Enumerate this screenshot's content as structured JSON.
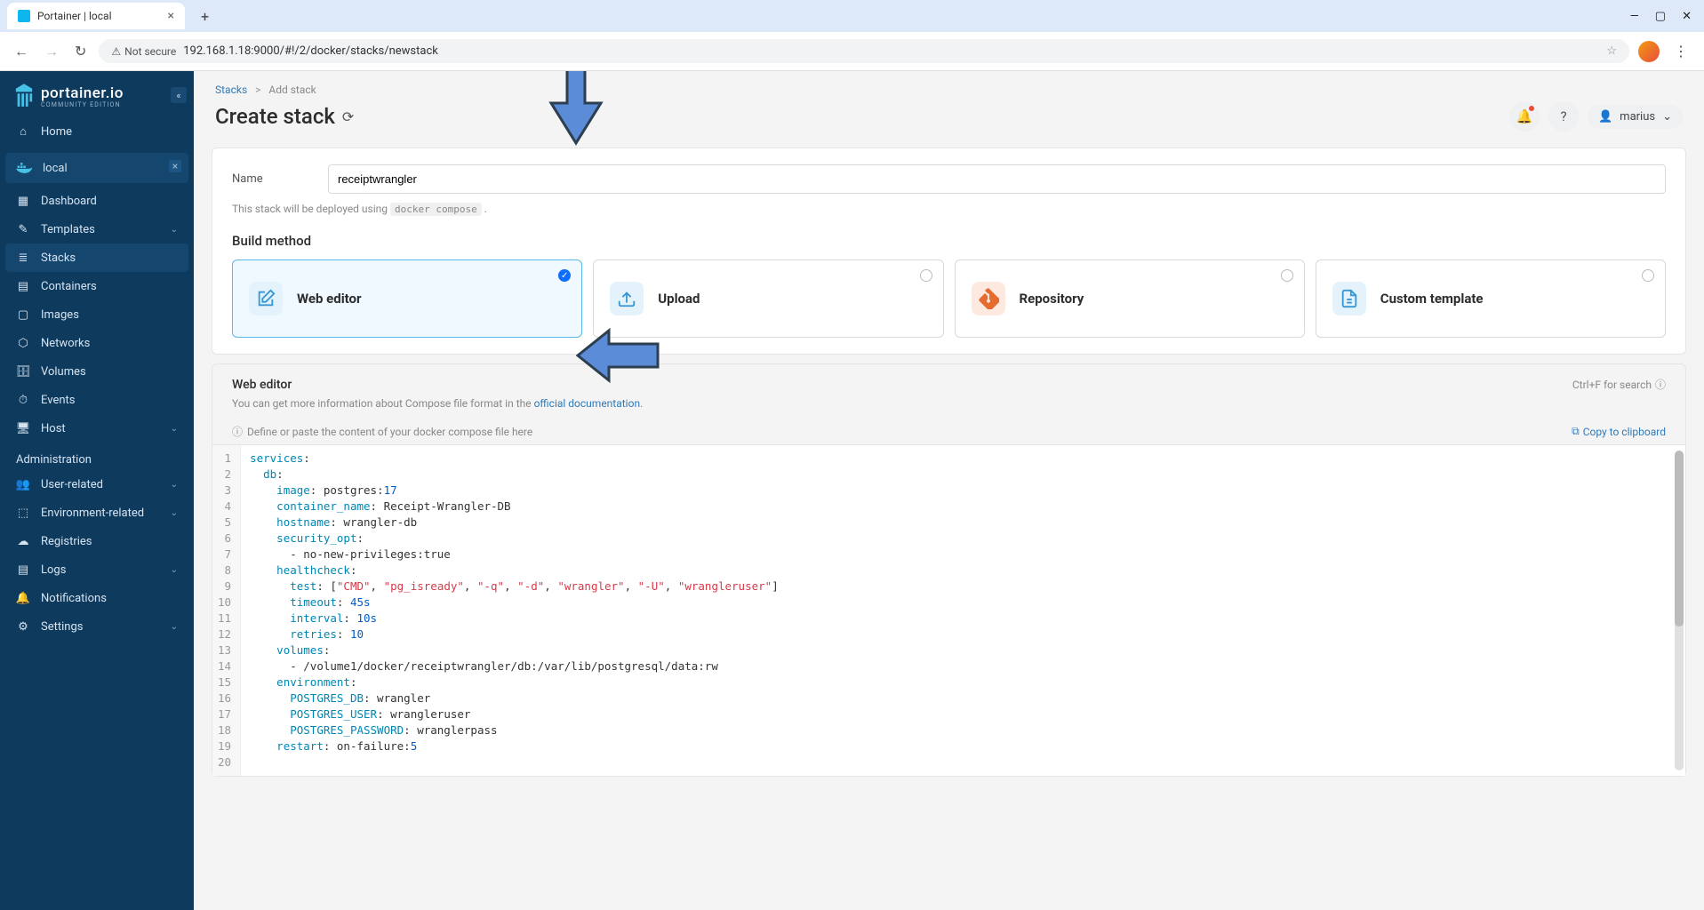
{
  "browser": {
    "tab_title": "Portainer | local",
    "security_label": "Not secure",
    "url": "192.168.1.18:9000/#!/2/docker/stacks/newstack"
  },
  "sidebar": {
    "brand": "portainer.io",
    "edition": "COMMUNITY EDITION",
    "home": "Home",
    "env_name": "local",
    "items": [
      {
        "label": "Dashboard"
      },
      {
        "label": "Templates",
        "chev": true
      },
      {
        "label": "Stacks",
        "active": true
      },
      {
        "label": "Containers"
      },
      {
        "label": "Images"
      },
      {
        "label": "Networks"
      },
      {
        "label": "Volumes"
      },
      {
        "label": "Events"
      },
      {
        "label": "Host",
        "chev": true
      }
    ],
    "admin_label": "Administration",
    "admin_items": [
      {
        "label": "User-related",
        "chev": true
      },
      {
        "label": "Environment-related",
        "chev": true
      },
      {
        "label": "Registries"
      },
      {
        "label": "Logs",
        "chev": true
      },
      {
        "label": "Notifications"
      },
      {
        "label": "Settings",
        "chev": true
      }
    ]
  },
  "breadcrumb": {
    "parent": "Stacks",
    "current": "Add stack"
  },
  "page": {
    "title": "Create stack",
    "username": "marius"
  },
  "form": {
    "name_label": "Name",
    "name_value": "receiptwrangler",
    "deploy_note_pre": "This stack will be deployed using ",
    "deploy_note_code": "docker compose",
    "build_method_label": "Build method"
  },
  "methods": [
    {
      "label": "Web editor",
      "selected": true,
      "icon": "edit",
      "tone": "blue"
    },
    {
      "label": "Upload",
      "icon": "upload",
      "tone": "blue"
    },
    {
      "label": "Repository",
      "icon": "git",
      "tone": "orange"
    },
    {
      "label": "Custom template",
      "icon": "template",
      "tone": "blue"
    }
  ],
  "editor": {
    "title": "Web editor",
    "search_hint": "Ctrl+F for search",
    "desc_pre": "You can get more information about Compose file format in the ",
    "desc_link": "official documentation",
    "hint": "Define or paste the content of your docker compose file here",
    "copy_label": "Copy to clipboard"
  },
  "code": {
    "lines": [
      [
        {
          "t": "services",
          "c": "k-key"
        },
        {
          "t": ":",
          "c": "k-punc"
        }
      ],
      [
        {
          "t": "  db",
          "c": "k-key"
        },
        {
          "t": ":",
          "c": "k-punc"
        }
      ],
      [
        {
          "t": "    image",
          "c": "k-key"
        },
        {
          "t": ": postgres:",
          "c": "k-punc"
        },
        {
          "t": "17",
          "c": "k-num"
        }
      ],
      [
        {
          "t": "    container_name",
          "c": "k-key"
        },
        {
          "t": ": Receipt-Wrangler-DB",
          "c": "k-punc"
        }
      ],
      [
        {
          "t": "    hostname",
          "c": "k-key"
        },
        {
          "t": ": wrangler-db",
          "c": "k-punc"
        }
      ],
      [
        {
          "t": "    security_opt",
          "c": "k-key"
        },
        {
          "t": ":",
          "c": "k-punc"
        }
      ],
      [
        {
          "t": "      - no-new-privileges:true",
          "c": "k-punc"
        }
      ],
      [
        {
          "t": "    healthcheck",
          "c": "k-key"
        },
        {
          "t": ":",
          "c": "k-punc"
        }
      ],
      [
        {
          "t": "      test",
          "c": "k-key"
        },
        {
          "t": ": [",
          "c": "k-punc"
        },
        {
          "t": "\"CMD\"",
          "c": "k-str"
        },
        {
          "t": ", ",
          "c": "k-punc"
        },
        {
          "t": "\"pg_isready\"",
          "c": "k-str"
        },
        {
          "t": ", ",
          "c": "k-punc"
        },
        {
          "t": "\"-q\"",
          "c": "k-str"
        },
        {
          "t": ", ",
          "c": "k-punc"
        },
        {
          "t": "\"-d\"",
          "c": "k-str"
        },
        {
          "t": ", ",
          "c": "k-punc"
        },
        {
          "t": "\"wrangler\"",
          "c": "k-str"
        },
        {
          "t": ", ",
          "c": "k-punc"
        },
        {
          "t": "\"-U\"",
          "c": "k-str"
        },
        {
          "t": ", ",
          "c": "k-punc"
        },
        {
          "t": "\"wrangleruser\"",
          "c": "k-str"
        },
        {
          "t": "]",
          "c": "k-punc"
        }
      ],
      [
        {
          "t": "      timeout",
          "c": "k-key"
        },
        {
          "t": ": ",
          "c": "k-punc"
        },
        {
          "t": "45s",
          "c": "k-num"
        }
      ],
      [
        {
          "t": "      interval",
          "c": "k-key"
        },
        {
          "t": ": ",
          "c": "k-punc"
        },
        {
          "t": "10s",
          "c": "k-num"
        }
      ],
      [
        {
          "t": "      retries",
          "c": "k-key"
        },
        {
          "t": ": ",
          "c": "k-punc"
        },
        {
          "t": "10",
          "c": "k-num"
        }
      ],
      [
        {
          "t": "    volumes",
          "c": "k-key"
        },
        {
          "t": ":",
          "c": "k-punc"
        }
      ],
      [
        {
          "t": "      - /volume1/docker/receiptwrangler/db:/var/lib/postgresql/data:rw",
          "c": "k-punc"
        }
      ],
      [
        {
          "t": "    environment",
          "c": "k-key"
        },
        {
          "t": ":",
          "c": "k-punc"
        }
      ],
      [
        {
          "t": "      POSTGRES_DB",
          "c": "k-key"
        },
        {
          "t": ": wrangler",
          "c": "k-punc"
        }
      ],
      [
        {
          "t": "      POSTGRES_USER",
          "c": "k-key"
        },
        {
          "t": ": wrangleruser",
          "c": "k-punc"
        }
      ],
      [
        {
          "t": "      POSTGRES_PASSWORD",
          "c": "k-key"
        },
        {
          "t": ": wranglerpass",
          "c": "k-punc"
        }
      ],
      [
        {
          "t": "    restart",
          "c": "k-key"
        },
        {
          "t": ": on-failure:",
          "c": "k-punc"
        },
        {
          "t": "5",
          "c": "k-num"
        }
      ],
      [
        {
          "t": "",
          "c": "k-punc"
        }
      ]
    ]
  }
}
